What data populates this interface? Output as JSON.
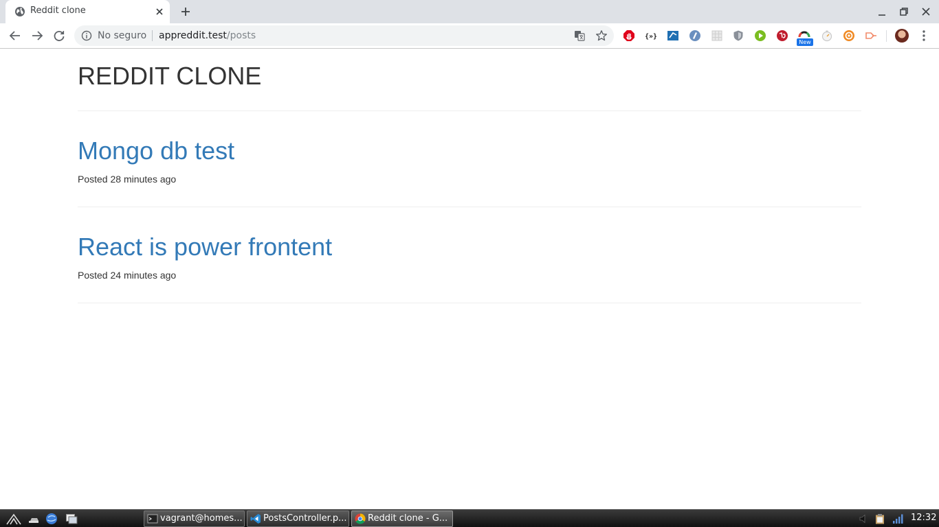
{
  "browser": {
    "tab": {
      "title": "Reddit clone",
      "favicon": "globe-icon"
    },
    "omnibox": {
      "security_label": "No seguro",
      "url_host": "appreddit.test",
      "url_path": "/posts"
    },
    "extensions": [
      "adblock-icon",
      "json-viewer-icon",
      "dashlane-icon",
      "page-ruler-icon",
      "grid-icon",
      "shield-icon",
      "play-icon",
      "lastpass-icon",
      "google-analytics-icon",
      "timer-icon",
      "colorzilla-icon",
      "share-icon"
    ],
    "extension_badge": "New"
  },
  "page": {
    "site_title": "REDDIT CLONE",
    "posts": [
      {
        "title": "Mongo db test",
        "meta": "Posted 28 minutes ago"
      },
      {
        "title": "React is power frontent",
        "meta": "Posted 24 minutes ago"
      }
    ]
  },
  "taskbar": {
    "tasks": [
      {
        "label": "vagrant@homes...",
        "icon": "terminal-icon"
      },
      {
        "label": "PostsController.p...",
        "icon": "vscode-icon"
      },
      {
        "label": "Reddit clone - G...",
        "icon": "chrome-icon"
      }
    ],
    "clock": "12:32"
  }
}
